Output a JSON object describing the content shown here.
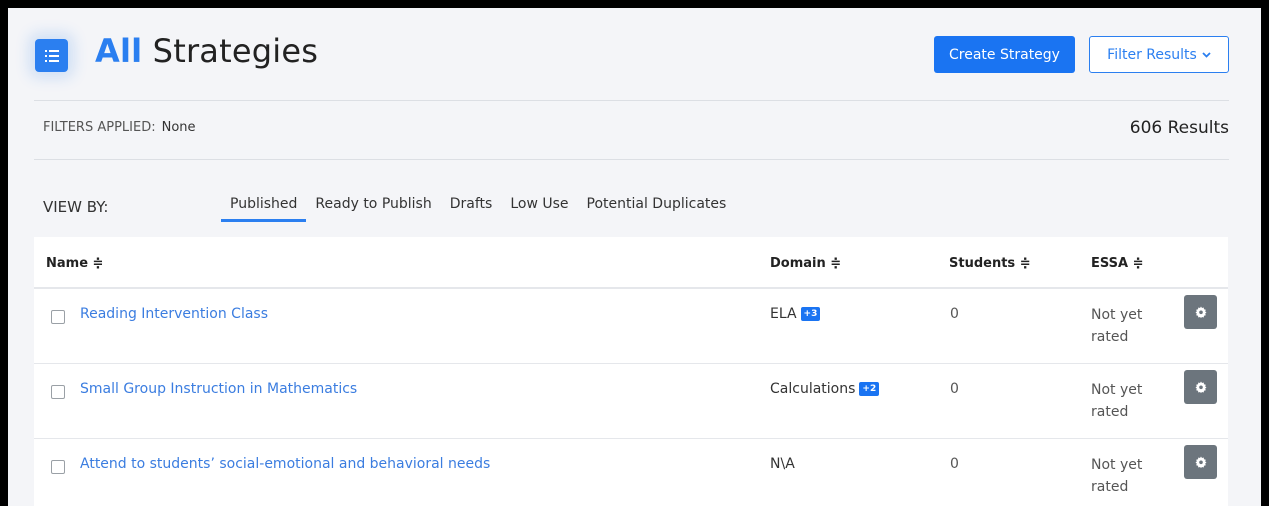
{
  "header": {
    "title_accent": "All",
    "title_rest": " Strategies",
    "create_label": "Create Strategy",
    "filter_label": "Filter Results",
    "logo_icon": "list-icon",
    "accent_color": "#2b7ff0"
  },
  "filters": {
    "label": "FILTERS APPLIED:",
    "value": "None",
    "results": "606 Results"
  },
  "viewby": {
    "label": "VIEW BY:",
    "tabs": [
      {
        "label": "Published",
        "active": true
      },
      {
        "label": "Ready to Publish",
        "active": false
      },
      {
        "label": "Drafts",
        "active": false
      },
      {
        "label": "Low Use",
        "active": false
      },
      {
        "label": "Potential Duplicates",
        "active": false
      }
    ]
  },
  "table": {
    "columns": {
      "name": "Name",
      "domain": "Domain",
      "students": "Students",
      "essa": "ESSA"
    },
    "rows": [
      {
        "name": "Reading Intervention Class",
        "domain": "ELA",
        "badge": "+3",
        "students": "0",
        "essa": "Not yet rated"
      },
      {
        "name": "Small Group Instruction in Mathematics",
        "domain": "Calculations",
        "badge": "+2",
        "students": "0",
        "essa": "Not yet rated"
      },
      {
        "name": "Attend to students’ social-emotional and behavioral needs",
        "domain": "N\\A",
        "badge": "",
        "students": "0",
        "essa": "Not yet rated"
      }
    ]
  }
}
